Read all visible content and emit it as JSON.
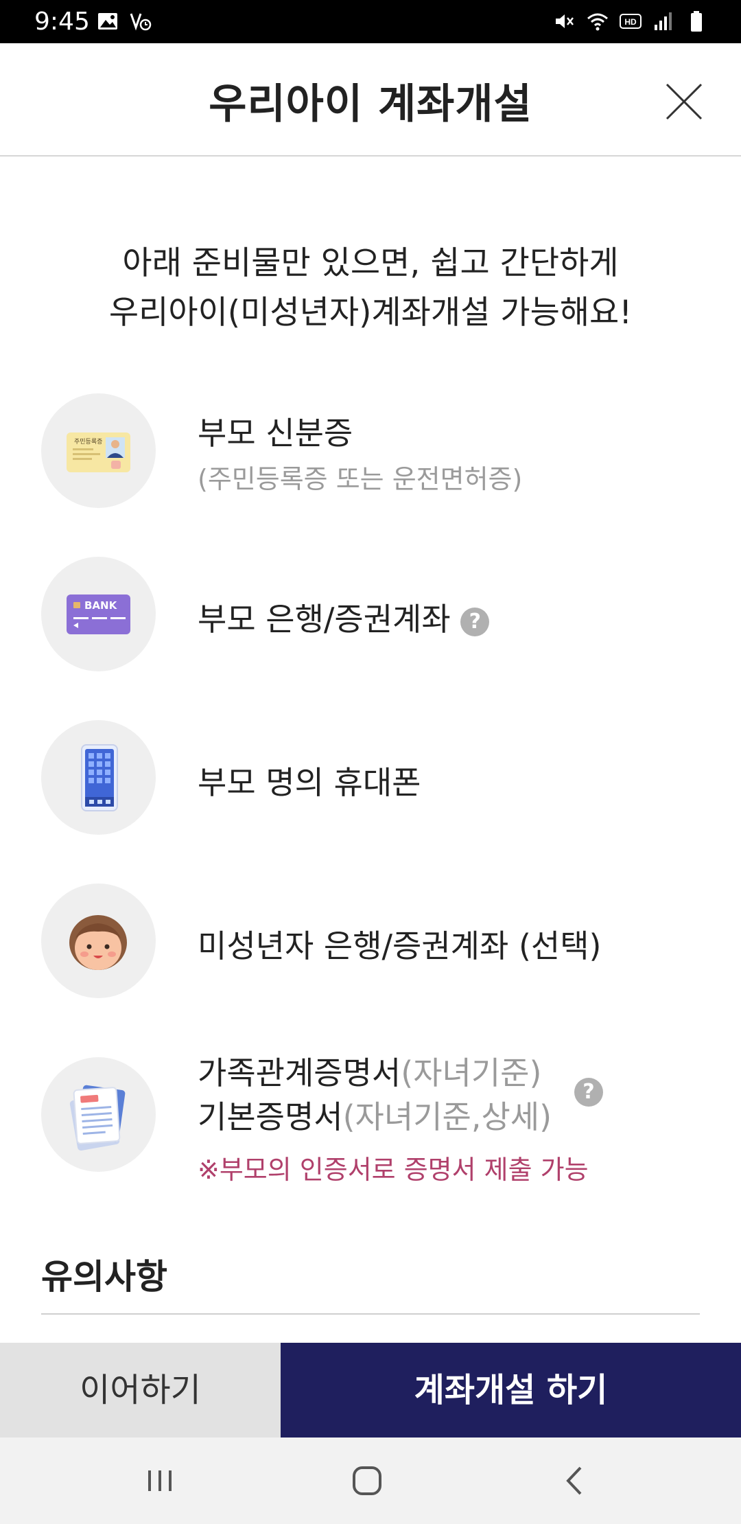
{
  "status_bar": {
    "time": "9:45",
    "left_icons": [
      "image-icon",
      "volte-icon"
    ],
    "right_icons": [
      "mute-icon",
      "wifi-icon",
      "hd-icon",
      "signal-icon",
      "battery-icon"
    ]
  },
  "header": {
    "title": "우리아이 계좌개설",
    "close_icon": "close-icon"
  },
  "intro": {
    "line1": "아래 준비물만 있으면, 쉽고 간단하게",
    "line2": "우리아이(미성년자)계좌개설 가능해요!"
  },
  "requirements": [
    {
      "icon": "id-card-icon",
      "title": "부모 신분증",
      "subtitle": "(주민등록증 또는 운전면허증)",
      "card_text": "주민등록증"
    },
    {
      "icon": "bank-card-icon",
      "title": "부모 은행/증권계좌",
      "help": "?",
      "card_text": "BANK"
    },
    {
      "icon": "smartphone-icon",
      "title": "부모 명의 휴대폰"
    },
    {
      "icon": "child-icon",
      "title": "미성년자 은행/증권계좌 (선택)"
    },
    {
      "icon": "document-icon",
      "title_line1": "가족관계증명서",
      "title_line1_note": "(자녀기준)",
      "title_line2": "기본증명서",
      "title_line2_note": "(자녀기준,상세)",
      "help": "?",
      "notice": "※부모의 인증서로 증명서 제출 가능"
    }
  ],
  "caution": {
    "title": "유의사항"
  },
  "buttons": {
    "continue_label": "이어하기",
    "open_account_label": "계좌개설 하기"
  },
  "nav_bar": {
    "icons": [
      "recent-apps-icon",
      "home-icon",
      "back-icon"
    ]
  },
  "colors": {
    "primary_button": "#1f1f5e",
    "secondary_button": "#e2e2e2",
    "notice_text": "#b0406b",
    "icon_circle": "#efefef",
    "bank_card": "#8b6fd6"
  }
}
